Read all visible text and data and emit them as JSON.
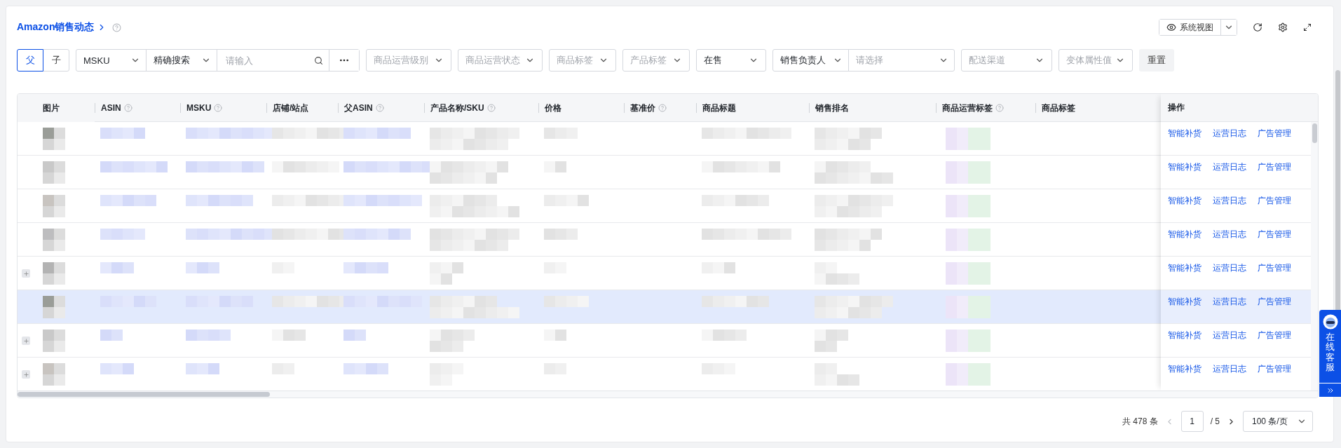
{
  "header": {
    "title": "Amazon销售动态",
    "view_button": "系统视图"
  },
  "filters": {
    "segments": [
      {
        "label": "父",
        "selected": true
      },
      {
        "label": "子",
        "selected": false
      }
    ],
    "search": {
      "field": "MSKU",
      "mode": "精确搜索",
      "placeholder": "请输入"
    },
    "selects": [
      {
        "kind": "select",
        "placeholder": "商品运营级别"
      },
      {
        "kind": "select",
        "placeholder": "商品运营状态"
      },
      {
        "kind": "select",
        "placeholder": "商品标签"
      },
      {
        "kind": "select",
        "placeholder": "产品标签"
      },
      {
        "kind": "select",
        "value": "在售"
      },
      {
        "kind": "combo",
        "label": "销售负责人",
        "placeholder": "请选择"
      },
      {
        "kind": "select",
        "placeholder": "配送渠道"
      },
      {
        "kind": "select",
        "placeholder": "变体属性值"
      }
    ],
    "reset_button": "重置"
  },
  "table": {
    "columns": [
      {
        "label": "图片",
        "help": false
      },
      {
        "label": "ASIN",
        "help": true
      },
      {
        "label": "MSKU",
        "help": true
      },
      {
        "label": "店铺/站点",
        "help": false
      },
      {
        "label": "父ASIN",
        "help": true
      },
      {
        "label": "产品名称/SKU",
        "help": true
      },
      {
        "label": "价格",
        "help": false
      },
      {
        "label": "基准价",
        "help": true
      },
      {
        "label": "商品标题",
        "help": false
      },
      {
        "label": "销售排名",
        "help": false
      },
      {
        "label": "商品运营标签",
        "help": true
      },
      {
        "label": "商品标签",
        "help": false
      }
    ],
    "action_column": "操作",
    "rows": [
      {
        "expandable": false,
        "selected": false,
        "actions": [
          "智能补货",
          "运营日志",
          "广告管理"
        ]
      },
      {
        "expandable": false,
        "selected": false,
        "actions": [
          "智能补货",
          "运营日志",
          "广告管理"
        ]
      },
      {
        "expandable": false,
        "selected": false,
        "actions": [
          "智能补货",
          "运营日志",
          "广告管理"
        ]
      },
      {
        "expandable": false,
        "selected": false,
        "actions": [
          "智能补货",
          "运营日志",
          "广告管理"
        ]
      },
      {
        "expandable": true,
        "selected": false,
        "actions": [
          "智能补货",
          "运营日志",
          "广告管理"
        ]
      },
      {
        "expandable": false,
        "selected": true,
        "actions": [
          "智能补货",
          "运营日志",
          "广告管理"
        ]
      },
      {
        "expandable": true,
        "selected": false,
        "actions": [
          "智能补货",
          "运营日志",
          "广告管理"
        ]
      },
      {
        "expandable": true,
        "selected": false,
        "actions": [
          "智能补货",
          "运营日志",
          "广告管理"
        ]
      }
    ]
  },
  "pagination": {
    "total": "共 478 条",
    "page": "1",
    "pages": "/ 5",
    "page_size": "100 条/页"
  },
  "support_widget": {
    "label": "在线客服"
  }
}
